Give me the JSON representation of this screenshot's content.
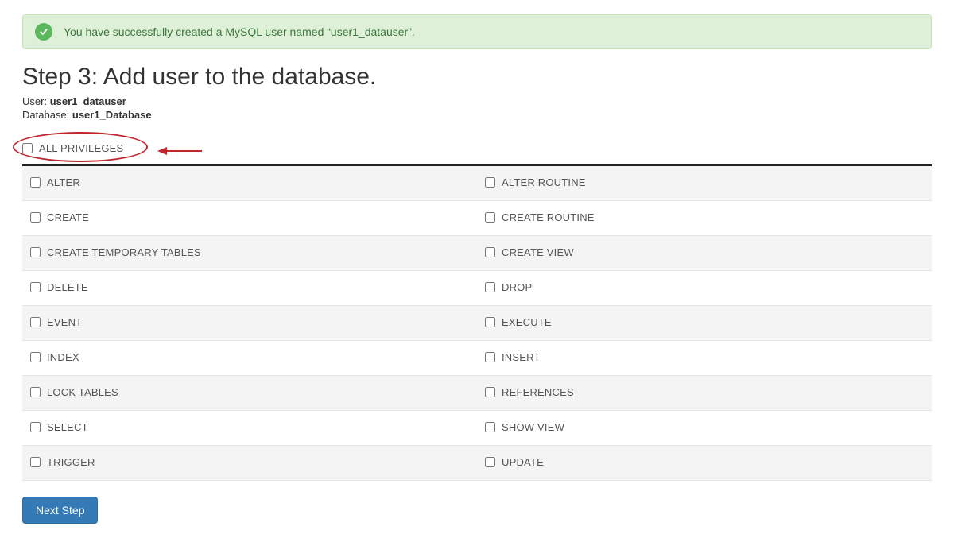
{
  "alert": {
    "icon": "check-icon",
    "message": "You have successfully created a MySQL user named “user1_datauser”."
  },
  "heading": "Step 3: Add user to the database.",
  "user": {
    "label": "User:",
    "value": "user1_datauser"
  },
  "db": {
    "label": "Database:",
    "value": "user1_Database"
  },
  "all_privileges_label": "ALL PRIVILEGES",
  "privileges": {
    "rows": [
      {
        "left": "ALTER",
        "right": "ALTER ROUTINE"
      },
      {
        "left": "CREATE",
        "right": "CREATE ROUTINE"
      },
      {
        "left": "CREATE TEMPORARY TABLES",
        "right": "CREATE VIEW"
      },
      {
        "left": "DELETE",
        "right": "DROP"
      },
      {
        "left": "EVENT",
        "right": "EXECUTE"
      },
      {
        "left": "INDEX",
        "right": "INSERT"
      },
      {
        "left": "LOCK TABLES",
        "right": "REFERENCES"
      },
      {
        "left": "SELECT",
        "right": "SHOW VIEW"
      },
      {
        "left": "TRIGGER",
        "right": "UPDATE"
      }
    ]
  },
  "next_button": "Next Step",
  "colors": {
    "alert_bg": "#dff0d8",
    "alert_border": "#c9e2b8",
    "alert_text": "#3c763d",
    "accent_btn": "#337ab7",
    "annotation": "#c0252e"
  }
}
